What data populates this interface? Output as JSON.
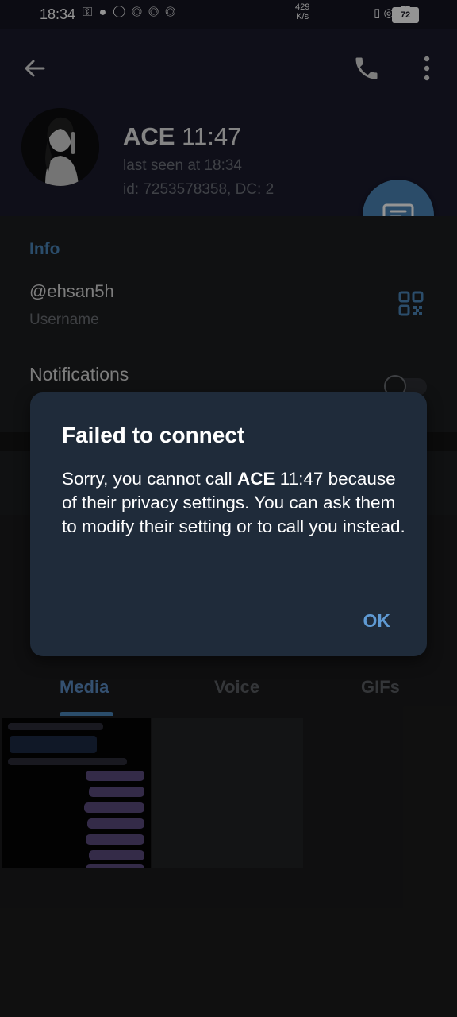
{
  "status_bar": {
    "time": "18:34",
    "left_icons": "⚿ ● ◯ ◎ ◎ ◎",
    "net_speed_value": "429",
    "net_speed_unit": "K/s",
    "right_icons": "▯ ◎ ▐▌",
    "battery": "72"
  },
  "header": {
    "name": "ACE",
    "name_suffix": "11:47",
    "last_seen": "last seen at 18:34",
    "user_id": "id: 7253578358, DC: 2"
  },
  "info": {
    "title": "Info",
    "username": "@ehsan5h",
    "username_label": "Username",
    "notifications_label": "Notifications"
  },
  "tabs": [
    "Media",
    "Voice",
    "GIFs"
  ],
  "dialog": {
    "title": "Failed to connect",
    "body_prefix": "Sorry, you cannot call",
    "body_name": "ACE",
    "body_suffix": "11:47 because of their privacy settings. You can ask them to modify their setting or to call you instead.",
    "ok_label": "OK"
  },
  "colors": {
    "accent": "#4a85b8",
    "dialog_bg": "#1f2b3a",
    "header_bg": "#1a1a2c"
  },
  "icons": {
    "back": "arrow-left-icon",
    "call": "phone-icon",
    "menu": "more-vert-icon",
    "fab": "message-icon",
    "qr": "qr-code-icon"
  }
}
